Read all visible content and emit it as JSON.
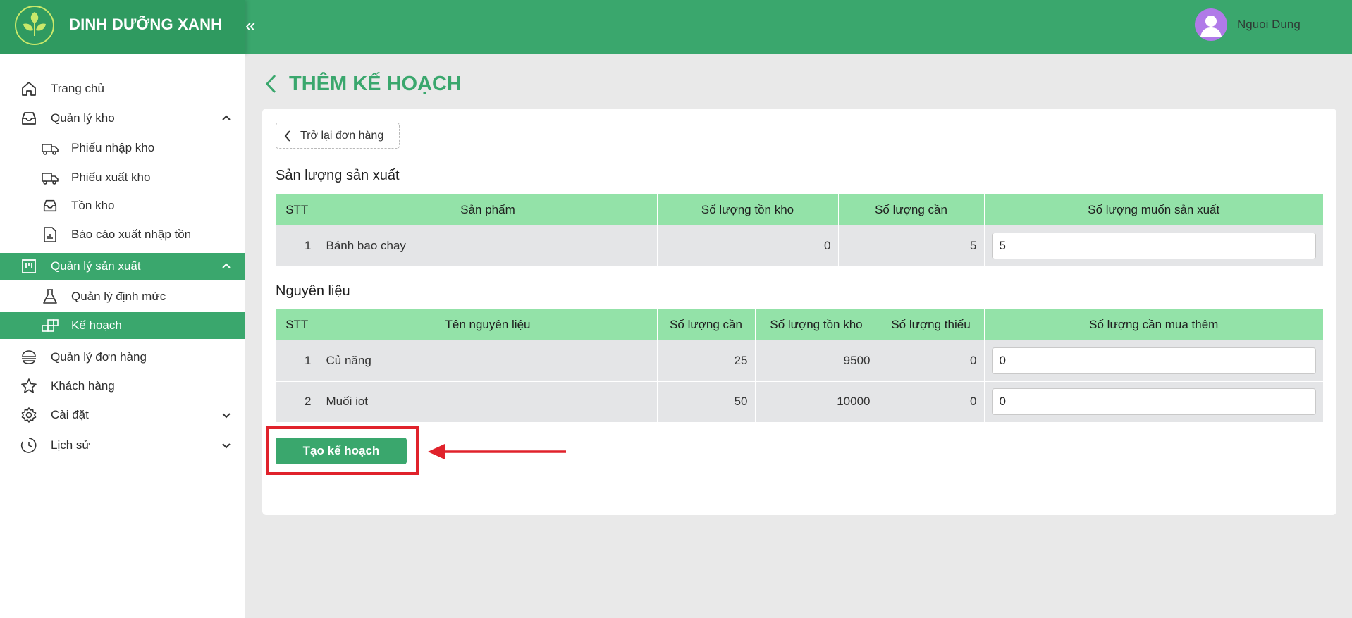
{
  "app": {
    "brand_name": "DINH DƯỠNG XANH",
    "user_name": "Nguoi Dung"
  },
  "colors": {
    "primary": "#3aa76d",
    "header_bg": "#3aa76d",
    "table_header_bg": "#93e2a8",
    "highlight": "#e0222b"
  },
  "sidebar": {
    "home": "Trang chủ",
    "warehouse": "Quản lý kho",
    "import_slip": "Phiếu nhập kho",
    "export_slip": "Phiếu xuất kho",
    "inventory": "Tồn kho",
    "report": "Báo cáo xuất nhập tồn",
    "production": "Quản lý sản xuất",
    "norms": "Quản lý định mức",
    "plan": "Kế hoạch",
    "orders": "Quản lý đơn hàng",
    "customers": "Khách hàng",
    "settings": "Cài đặt",
    "history": "Lịch sử"
  },
  "page": {
    "title": "THÊM KẾ HOẠCH",
    "back_link": "Trở lại đơn hàng",
    "create_button": "Tạo kế hoạch"
  },
  "production": {
    "title": "Sản lượng sản xuất",
    "headers": {
      "stt": "STT",
      "product": "Sản phẩm",
      "stock": "Số lượng tồn kho",
      "needed": "Số lượng cần",
      "desired": "Số lượng muốn sản xuất"
    },
    "rows": [
      {
        "stt": "1",
        "product": "Bánh bao chay",
        "stock": "0",
        "needed": "5",
        "desired": "5"
      }
    ]
  },
  "materials": {
    "title": "Nguyên liệu",
    "headers": {
      "stt": "STT",
      "name": "Tên nguyên liệu",
      "needed": "Số lượng cần",
      "stock": "Số lượng tồn kho",
      "missing": "Số lượng thiếu",
      "to_buy": "Số lượng cần mua thêm"
    },
    "rows": [
      {
        "stt": "1",
        "name": "Củ năng",
        "needed": "25",
        "stock": "9500",
        "missing": "0",
        "to_buy": "0"
      },
      {
        "stt": "2",
        "name": "Muối iot",
        "needed": "50",
        "stock": "10000",
        "missing": "0",
        "to_buy": "0"
      }
    ]
  }
}
